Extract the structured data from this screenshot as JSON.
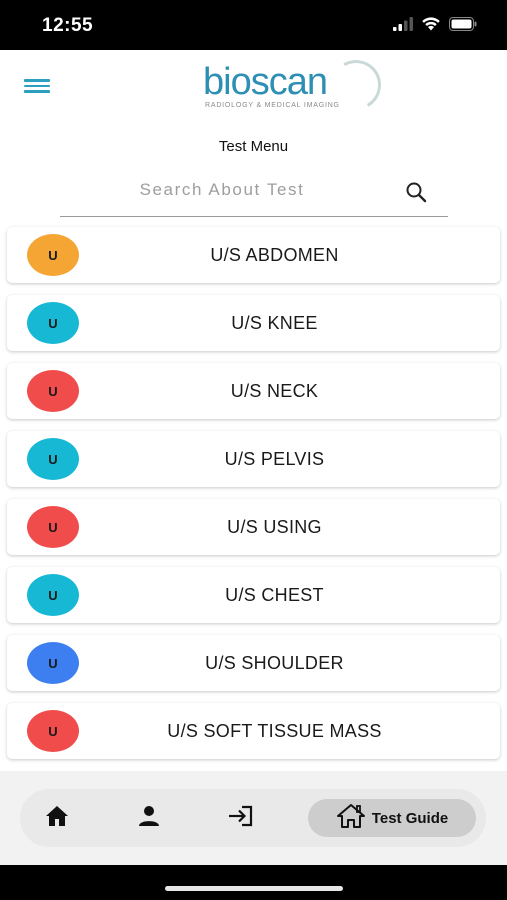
{
  "status_bar": {
    "time": "12:55"
  },
  "header": {
    "logo_text": "bioscan",
    "logo_subtitle": "RADIOLOGY & MEDICAL IMAGING"
  },
  "page_title": "Test Menu",
  "search": {
    "placeholder": "Search About Test",
    "value": ""
  },
  "tests": [
    {
      "badge": "U",
      "label": "U/S ABDOMEN",
      "color": "#f4a534"
    },
    {
      "badge": "U",
      "label": "U/S KNEE",
      "color": "#16b8d4"
    },
    {
      "badge": "U",
      "label": "U/S NECK",
      "color": "#f04c4c"
    },
    {
      "badge": "U",
      "label": "U/S PELVIS",
      "color": "#16b8d4"
    },
    {
      "badge": "U",
      "label": "U/S USING",
      "color": "#f04c4c"
    },
    {
      "badge": "U",
      "label": "U/S CHEST",
      "color": "#16b8d4"
    },
    {
      "badge": "U",
      "label": "U/S SHOULDER",
      "color": "#3d7ff0"
    },
    {
      "badge": "U",
      "label": "U/S SOFT TISSUE MASS",
      "color": "#f04c4c"
    }
  ],
  "bottom_nav": {
    "items": [
      {
        "icon": "home-icon"
      },
      {
        "icon": "person-icon"
      },
      {
        "icon": "login-icon"
      },
      {
        "icon": "home-outline-icon",
        "label": "Test Guide",
        "active": true
      }
    ]
  },
  "colors": {
    "accent": "#2e8fb5",
    "tab_active": "#cdcdcd"
  }
}
